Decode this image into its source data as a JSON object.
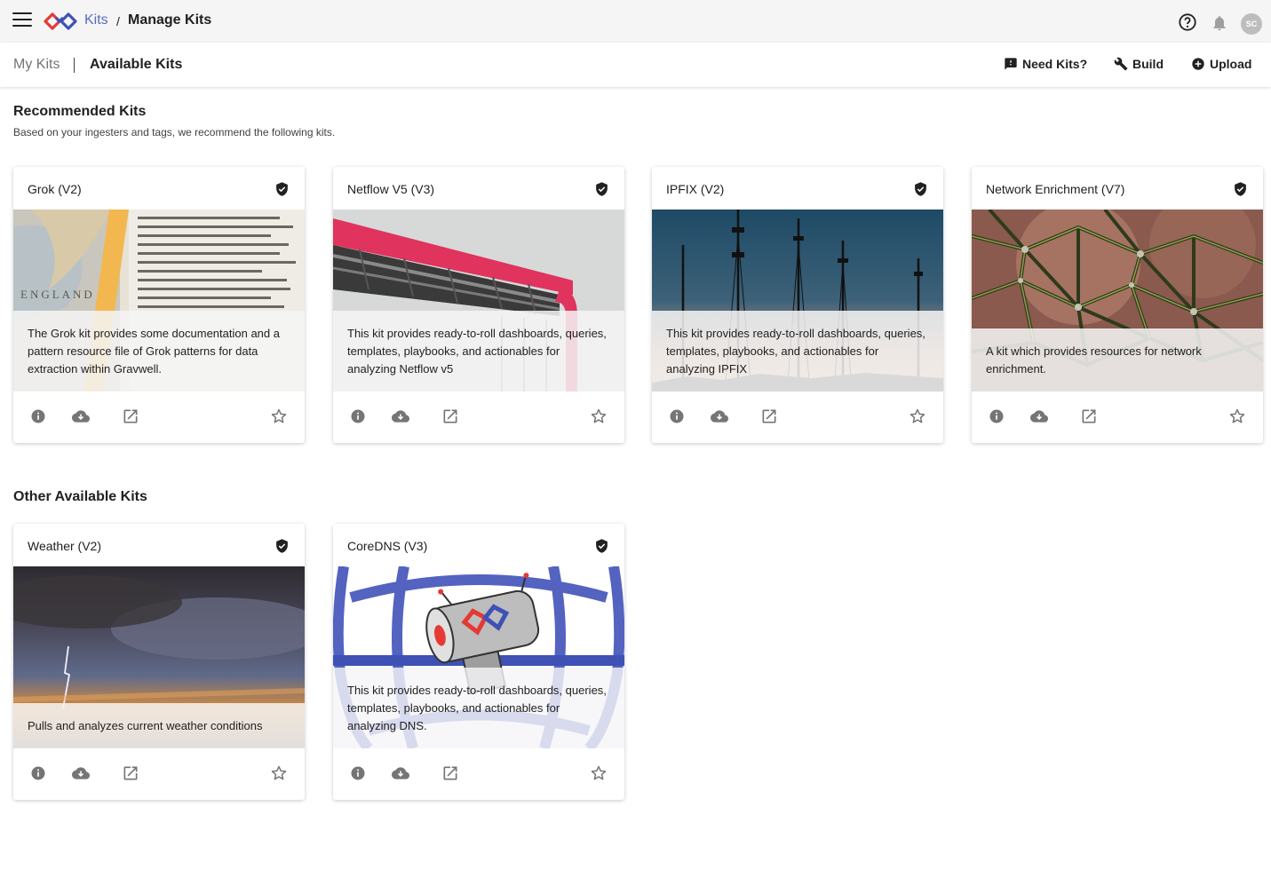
{
  "app": {
    "breadcrumb_link": "Kits",
    "breadcrumb_sep": "/",
    "breadcrumb_current": "Manage Kits",
    "avatar_initials": "SC",
    "icons": [
      "menu-icon",
      "gravwell-logo",
      "help-icon",
      "bell-icon"
    ]
  },
  "subnav": {
    "tab_mykits": "My Kits",
    "tab_available": "Available Kits",
    "need_kits": "Need Kits?",
    "build": "Build",
    "upload": "Upload"
  },
  "recommended": {
    "title": "Recommended Kits",
    "subtitle": "Based on your ingesters and tags, we recommend the following kits.",
    "cards": [
      {
        "title": "Grok (V2)",
        "description": "The Grok kit provides some documentation and a pattern resource file of Grok patterns for data extraction within Gravwell.",
        "image": "dictionary-england-photo"
      },
      {
        "title": "Netflow V5 (V3)",
        "description": "This kit provides ready-to-roll dashboards, queries, templates, playbooks, and actionables for analyzing Netflow v5",
        "image": "pipeline-bridge-photo"
      },
      {
        "title": "IPFIX (V2)",
        "description": "This kit provides ready-to-roll dashboards, queries, templates, playbooks, and actionables for analyzing IPFIX",
        "image": "antenna-towers-photo"
      },
      {
        "title": "Network Enrichment (V7)",
        "description": "A kit which provides resources for network enrichment.",
        "image": "rope-net-photo"
      }
    ]
  },
  "other": {
    "title": "Other Available Kits",
    "cards": [
      {
        "title": "Weather (V2)",
        "description": "Pulls and analyzes current weather conditions",
        "image": "lightning-storm-photo"
      },
      {
        "title": "CoreDNS (V3)",
        "description": "This kit provides ready-to-roll dashboards, queries, templates, playbooks, and actionables for analyzing DNS.",
        "image": "globe-robot-illustration"
      }
    ]
  },
  "card_actions": [
    "info-icon",
    "cloud-download-icon",
    "open-in-new-icon",
    "star-outline-icon"
  ],
  "colors": {
    "accent": "#5c6bc0",
    "logo_red": "#e53935",
    "logo_blue": "#3f51b5",
    "topbar": "#f5f5f5"
  }
}
